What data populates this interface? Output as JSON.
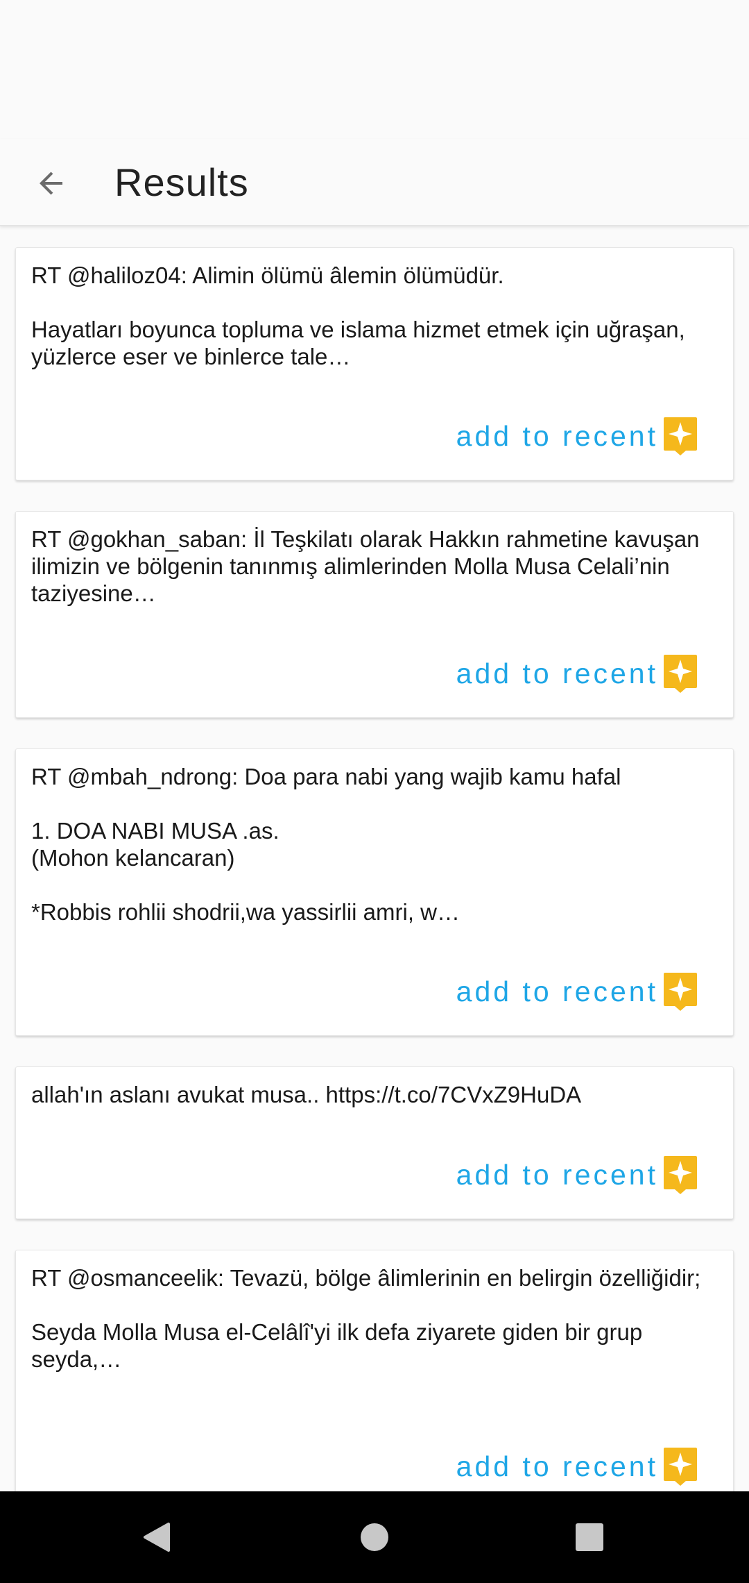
{
  "header": {
    "title": "Results",
    "back_icon": "arrow-left-icon"
  },
  "results": [
    {
      "text": "RT @haliloz04: Alimin ölümü âlemin ölümüdür.\n\nHayatları boyunca topluma ve islama hizmet etmek için uğraşan, yüzlerce eser ve binlerce tale…",
      "action": "add to recent"
    },
    {
      "text": "RT @gokhan_saban: İl Teşkilatı olarak Hakkın rahmetine kavuşan ilimizin ve bölgenin tanınmış alimlerinden Molla Musa Celali’nin taziyesine…",
      "action": "add to recent"
    },
    {
      "text": "RT @mbah_ndrong: Doa para nabi yang wajib kamu hafal\n\n1. DOA NABI MUSA .as.\n(Mohon kelancaran)\n\n*Robbis rohlii shodrii,wa yassirlii amri, w…",
      "action": "add to recent"
    },
    {
      "text": "allah'ın aslanı avukat musa.. https://t.co/7CVxZ9HuDA",
      "action": "add to recent"
    },
    {
      "text": "RT @osmanceelik: Tevazü, bölge âlimlerinin en belirgin özelliğidir;\n\nSeyda Molla Musa el-Celâlî'yi ilk defa ziyarete giden bir grup seyda,…",
      "action": "add to recent"
    }
  ],
  "colors": {
    "accent": "#1ea6e6",
    "sparkle": "#f5b81c",
    "nav_bar": "#000000"
  },
  "nav": {
    "back_icon": "triangle-back-icon",
    "home_icon": "circle-home-icon",
    "recents_icon": "square-recents-icon"
  }
}
